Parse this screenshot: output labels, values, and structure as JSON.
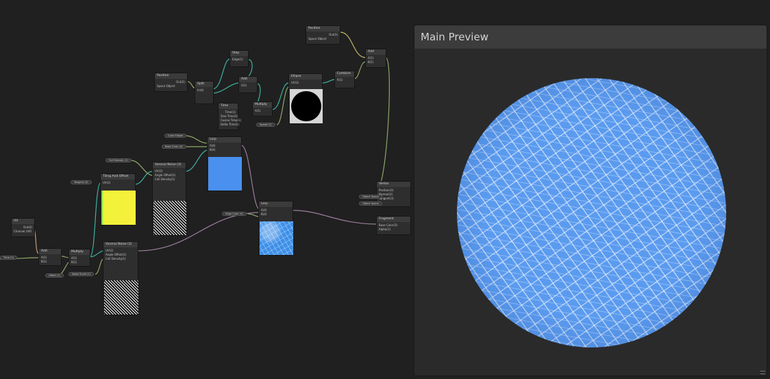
{
  "preview": {
    "title": "Main Preview",
    "accent": "#5b9bef"
  },
  "graph": {
    "wire_colors": {
      "float": "#8ea86a",
      "vector": "#3fb2a2",
      "uv": "#c79b7d",
      "output": "#9b7e9d"
    },
    "nodes": {
      "time": {
        "title": "Time",
        "rows": [
          "Time(1)",
          "Sine Time(1)",
          "Cosine Time(1)",
          "Delta Time(1)",
          "Smooth Delta(1)"
        ]
      },
      "voronoi_a": {
        "title": "Voronoi Noise (2)",
        "rows": [
          "UV(2)",
          "Angle Offset(1)",
          "Cell Density(1)",
          "Out(1)",
          "Cells(1)"
        ]
      },
      "voronoi_b": {
        "title": "Voronoi Noise (2)",
        "rows": [
          "UV(2)",
          "Angle Offset(1)",
          "Cell Density(1)",
          "Out(1)",
          "Cells(1)"
        ]
      },
      "lerp_a": {
        "title": "Lerp",
        "rows": [
          "A(4)",
          "B(4)",
          "T(4)",
          "Out(4)"
        ]
      },
      "lerp_b": {
        "title": "Lerp",
        "rows": [
          "A(4)",
          "B(4)",
          "T(4)",
          "Out(4)"
        ]
      },
      "uv": {
        "title": "UV",
        "rows": [
          "Out(4)",
          "Channel UV0"
        ]
      },
      "add": {
        "title": "Add",
        "rows": [
          "A(1)",
          "B(1)",
          "Out(1)"
        ]
      },
      "multiply": {
        "title": "Multiply",
        "rows": [
          "A(1)",
          "B(1)",
          "Out(1)"
        ]
      },
      "tiling": {
        "title": "Tiling And Offset",
        "rows": [
          "UV(2)",
          "Tiling(2)",
          "Offset(2)",
          "Out(2)"
        ]
      },
      "split": {
        "title": "Split",
        "rows": [
          "In(4)",
          "R(1)",
          "G(1)",
          "B(1)",
          "A(1)"
        ]
      },
      "ellipse": {
        "title": "Ellipse",
        "rows": [
          "UV(2)",
          "Width(1)",
          "Height(1)",
          "Out(1)"
        ]
      },
      "step": {
        "title": "Step",
        "rows": [
          "Edge(1)",
          "In(1)",
          "Out(1)"
        ]
      },
      "combine": {
        "title": "Combine",
        "rows": [
          "R(1)",
          "G(1)",
          "Out(4)"
        ]
      },
      "vertex": {
        "title": "Vertex",
        "rows": [
          "Position(3)",
          "Normal(3)",
          "Tangent(3)"
        ]
      },
      "fragment": {
        "title": "Fragment",
        "rows": [
          "Base Color(3)",
          "Alpha(1)"
        ]
      },
      "position": {
        "title": "Position",
        "rows": [
          "Out(3)",
          "Space Object"
        ]
      },
      "add_top": {
        "title": "Add",
        "rows": [
          "A(1)",
          "B(1)",
          "Out(1)"
        ]
      }
    },
    "pills": [
      "Color Ellipse",
      "Base Color (4)",
      "Edge Color (4)",
      "Cell Density (1)",
      "Offset (1)",
      "Noise Scale (1)",
      "Speed (1)",
      "Object Space",
      "Object Space",
      "Tangent (3)",
      "Time (1)"
    ]
  }
}
